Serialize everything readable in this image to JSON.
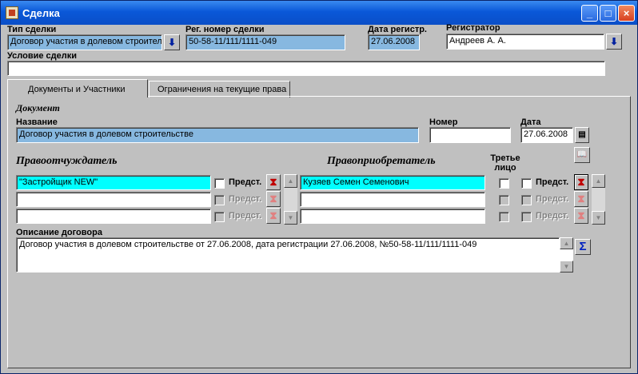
{
  "window": {
    "title": "Сделка"
  },
  "deal_type": {
    "label": "Тип сделки",
    "value": "Договор участия в долевом строител"
  },
  "reg_number": {
    "label": "Рег. номер сделки",
    "value": "50-58-11/111/1111-049"
  },
  "reg_date": {
    "label": "Дата регистр.",
    "value": "27.06.2008"
  },
  "registrar": {
    "label": "Регистратор",
    "value": "Андреев А. А."
  },
  "condition": {
    "label": "Условие сделки",
    "value": ""
  },
  "tabs": [
    {
      "label": "Документы и Участники",
      "active": true
    },
    {
      "label": "Ограничения на текущие права",
      "active": false
    }
  ],
  "document": {
    "section": "Документ",
    "name_label": "Название",
    "name_value": "Договор участия в долевом строительстве",
    "number_label": "Номер",
    "number_value": "",
    "date_label": "Дата",
    "date_value": "27.06.2008"
  },
  "alienator": {
    "heading": "Правоотчуждатель",
    "rows": [
      "\"Застройщик NEW\"",
      "",
      ""
    ],
    "rep_label": "Предст."
  },
  "acquirer": {
    "heading": "Правоприобретатель",
    "third_party_label": "Третье лицо",
    "rows": [
      "Кузяев Семен Семенович",
      "",
      ""
    ],
    "rep_label": "Предст."
  },
  "contract": {
    "label": "Описание договора",
    "value": "Договор участия в долевом строительстве от 27.06.2008, дата регистрации 27.06.2008, №50-58-11/111/1111-049"
  },
  "icons": {
    "dropdown": "down-arrow-icon",
    "sum": "Σ",
    "hourglass": "⧗"
  },
  "colors": {
    "selected_field": "#87b8e0",
    "active_row": "#00ffff",
    "titlebar": "#0a58d8"
  }
}
